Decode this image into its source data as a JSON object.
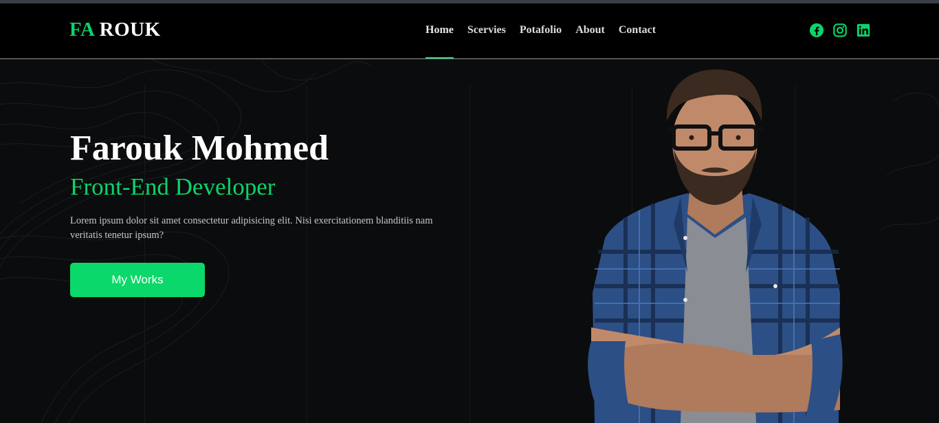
{
  "logo": {
    "part1": "FA",
    "part2": "ROUK"
  },
  "nav": {
    "items": [
      {
        "label": "Home",
        "active": true
      },
      {
        "label": "Scervies",
        "active": false
      },
      {
        "label": "Potafolio",
        "active": false
      },
      {
        "label": "About",
        "active": false
      },
      {
        "label": "Contact",
        "active": false
      }
    ]
  },
  "social": {
    "icons": [
      "facebook-icon",
      "instagram-icon",
      "linkedin-icon"
    ]
  },
  "hero": {
    "name": "Farouk Mohmed",
    "role": "Front-End Developer",
    "description": "Lorem ipsum dolor sit amet consectetur adipisicing elit. Nisi exercitationem blanditiis nam veritatis tenetur ipsum?",
    "button": "My Works"
  },
  "colors": {
    "accent": "#0bd46a",
    "background": "#0b0c0d",
    "header": "#000000",
    "text": "#ffffff"
  }
}
